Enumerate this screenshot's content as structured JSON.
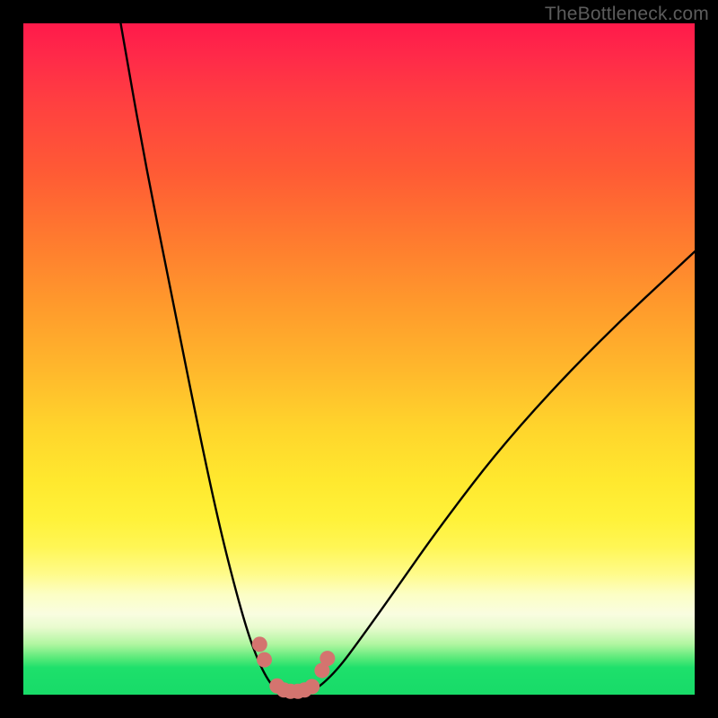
{
  "watermark": "TheBottleneck.com",
  "colors": {
    "curve_stroke": "#000000",
    "marker_fill": "#d4746f",
    "background": "#000000"
  },
  "chart_data": {
    "type": "line",
    "title": "",
    "xlabel": "",
    "ylabel": "",
    "xlim": [
      0,
      100
    ],
    "ylim": [
      0,
      100
    ],
    "gradient_bands": [
      {
        "color": "#ff1a4a",
        "pos": 0
      },
      {
        "color": "#ff7a2f",
        "pos": 32
      },
      {
        "color": "#ffe82e",
        "pos": 68
      },
      {
        "color": "#fffb8a",
        "pos": 82
      },
      {
        "color": "#1ee06b",
        "pos": 96
      },
      {
        "color": "#18db68",
        "pos": 100
      }
    ],
    "series": [
      {
        "name": "left-branch",
        "note": "y is % from bottom; x is % from left",
        "x": [
          14.5,
          18,
          22,
          26,
          29,
          31.5,
          33.5,
          35,
          36.2,
          37.2,
          38
        ],
        "y": [
          100,
          80,
          60,
          40,
          26,
          16,
          9,
          5,
          2.6,
          1.2,
          0.6
        ]
      },
      {
        "name": "right-branch",
        "x": [
          43,
          44.5,
          47,
          50,
          55,
          62,
          72,
          85,
          100
        ],
        "y": [
          0.6,
          1.5,
          4,
          8,
          15,
          25,
          38,
          52,
          66
        ]
      },
      {
        "name": "valley-floor",
        "x": [
          38,
          39,
          40,
          41,
          42,
          43
        ],
        "y": [
          0.6,
          0.4,
          0.35,
          0.35,
          0.4,
          0.6
        ]
      }
    ],
    "markers": {
      "name": "highlighted-points",
      "fill": "#d4746f",
      "points": [
        {
          "x": 35.2,
          "y": 7.5
        },
        {
          "x": 35.9,
          "y": 5.2
        },
        {
          "x": 37.8,
          "y": 1.3
        },
        {
          "x": 38.8,
          "y": 0.7
        },
        {
          "x": 39.8,
          "y": 0.5
        },
        {
          "x": 40.9,
          "y": 0.5
        },
        {
          "x": 41.9,
          "y": 0.7
        },
        {
          "x": 43.0,
          "y": 1.2
        },
        {
          "x": 44.5,
          "y": 3.6
        },
        {
          "x": 45.3,
          "y": 5.4
        }
      ]
    }
  }
}
